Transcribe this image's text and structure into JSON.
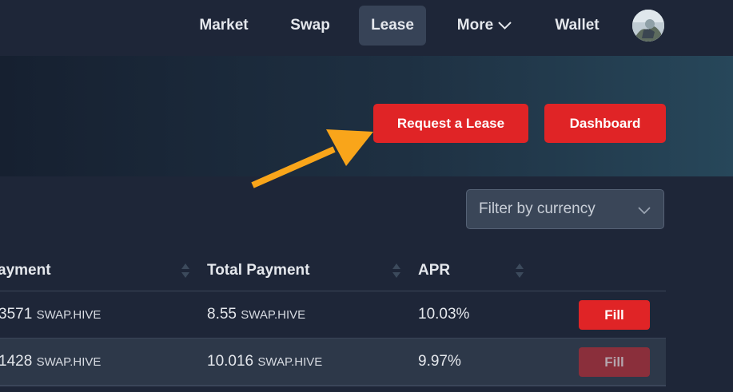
{
  "nav": {
    "items": [
      {
        "label": "Market"
      },
      {
        "label": "Swap"
      },
      {
        "label": "Lease",
        "active": true
      },
      {
        "label": "More"
      },
      {
        "label": "Wallet"
      }
    ]
  },
  "hero": {
    "request_lease_label": "Request a Lease",
    "dashboard_label": "Dashboard"
  },
  "filter": {
    "label": "Filter by currency"
  },
  "table": {
    "headers": [
      "ayment",
      "Total Payment",
      "APR"
    ],
    "rows": [
      {
        "payment": "3571",
        "payment_unit": "SWAP.HIVE",
        "total": "8.55",
        "total_unit": "SWAP.HIVE",
        "apr": "10.03%",
        "action": "Fill",
        "disabled": false
      },
      {
        "payment": "1428",
        "payment_unit": "SWAP.HIVE",
        "total": "10.016",
        "total_unit": "SWAP.HIVE",
        "apr": "9.97%",
        "action": "Fill",
        "disabled": true
      }
    ]
  },
  "colors": {
    "accent_red": "#e02426",
    "arrow_orange": "#f9a51a",
    "background": "#1e2638"
  },
  "icons": {
    "more_dropdown": "chevron-down-icon",
    "filter_dropdown": "chevron-down-icon",
    "sort": "sort-icon",
    "annotation": "arrow-icon"
  }
}
